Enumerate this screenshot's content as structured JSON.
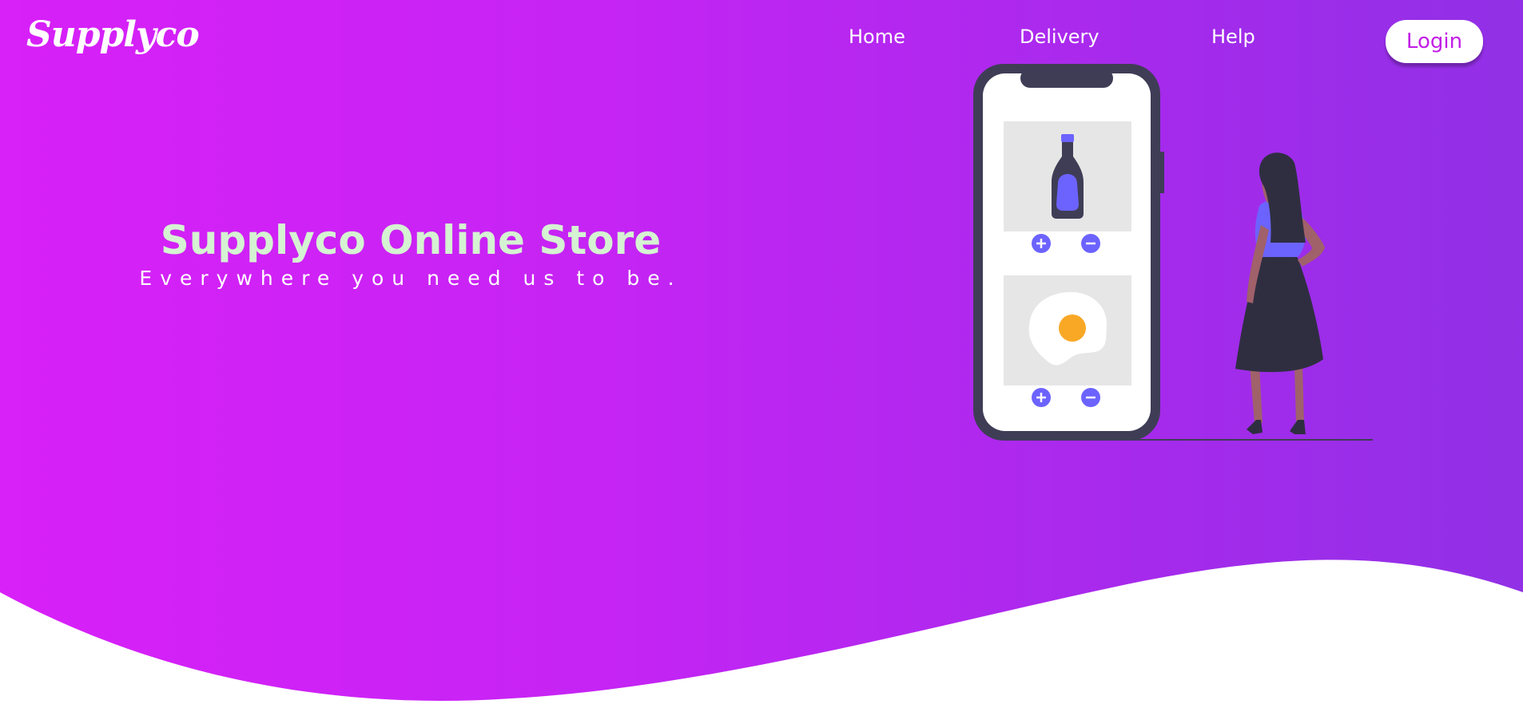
{
  "brand": {
    "logo_text": "Supplyco"
  },
  "nav": {
    "links": [
      {
        "label": "Home"
      },
      {
        "label": "Delivery"
      },
      {
        "label": "Help"
      }
    ],
    "login_label": "Login"
  },
  "hero": {
    "title": "Supplyco Online Store",
    "subtitle": "Everywhere you need us to be."
  },
  "illustration": {
    "products": [
      {
        "icon": "bottle-icon"
      },
      {
        "icon": "fried-egg-icon"
      }
    ],
    "add_icon": "plus-icon",
    "remove_icon": "minus-icon"
  },
  "colors": {
    "gradient_start": "#d820f8",
    "gradient_end": "#9130e6",
    "title_color": "#d5f2d2",
    "accent": "#6c63ff",
    "dark": "#3f3d56"
  }
}
